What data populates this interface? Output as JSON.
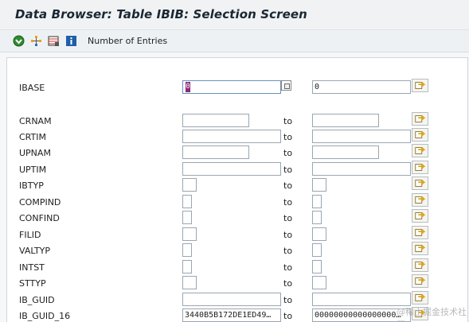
{
  "window": {
    "title": "Data Browser: Table IBIB: Selection Screen"
  },
  "toolbar": {
    "icons": [
      "execute-icon",
      "program-icon",
      "layout-icon",
      "info-icon"
    ],
    "number_of_entries_label": "Number of Entries"
  },
  "selection": {
    "to_label": "to",
    "rows": [
      {
        "name": "IBASE",
        "low": "0",
        "high": "0"
      },
      {
        "name": "CRNAM",
        "low": "",
        "high": ""
      },
      {
        "name": "CRTIM",
        "low": "",
        "high": ""
      },
      {
        "name": "UPNAM",
        "low": "",
        "high": ""
      },
      {
        "name": "UPTIM",
        "low": "",
        "high": ""
      },
      {
        "name": "IBTYP",
        "low": "",
        "high": ""
      },
      {
        "name": "COMPIND",
        "low": "",
        "high": ""
      },
      {
        "name": "CONFIND",
        "low": "",
        "high": ""
      },
      {
        "name": "FILID",
        "low": "",
        "high": ""
      },
      {
        "name": "VALTYP",
        "low": "",
        "high": ""
      },
      {
        "name": "INTST",
        "low": "",
        "high": ""
      },
      {
        "name": "STTYP",
        "low": "",
        "high": ""
      },
      {
        "name": "IB_GUID",
        "low": "",
        "high": ""
      },
      {
        "name": "IB_GUID_16",
        "low": "3440B5B172DE1ED49…",
        "high": "00000000000000000…"
      }
    ]
  },
  "watermark": "@稀土掘金技术社区"
}
